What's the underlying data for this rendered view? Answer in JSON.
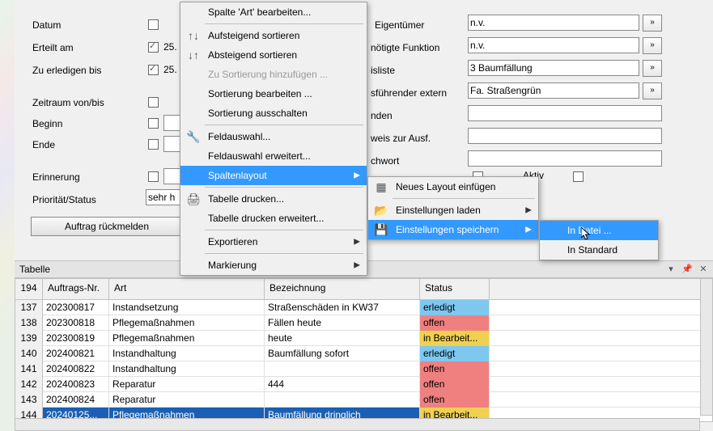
{
  "form": {
    "left": {
      "datum": "Datum",
      "erteilt_am": "Erteilt am",
      "erteilt_am_val": "25.",
      "zu_erledigen_bis": "Zu erledigen bis",
      "zu_erledigen_bis_val": "25.",
      "zeitraum": "Zeitraum von/bis",
      "beginn": "Beginn",
      "ende": "Ende",
      "erinnerung": "Erinnerung",
      "prioritaet": "Priorität/Status",
      "prioritaet_val": "sehr h"
    },
    "right": {
      "eigentuemer": "Eigentümer",
      "eigentuemer_val": "n.v.",
      "funktion": "nötigte Funktion",
      "funktion_val": "n.v.",
      "preisliste": "isliste",
      "preisliste_val": "3 Baumfällung",
      "extern": "sführender extern",
      "extern_val": "Fa. Straßengrün",
      "enden": "nden",
      "ausf": "weis zur Ausf.",
      "chwort": "chwort",
      "aktiv": "Aktiv"
    },
    "rueckmelden": "Auftrag rückmelden"
  },
  "menu": {
    "art_bearbeiten": "Spalte 'Art' bearbeiten...",
    "asc": "Aufsteigend sortieren",
    "desc": "Absteigend sortieren",
    "zu_sort": "Zu Sortierung hinzufügen ...",
    "sort_bearb": "Sortierung bearbeiten ...",
    "sort_aus": "Sortierung ausschalten",
    "feldaus": "Feldauswahl...",
    "feldaus_erw": "Feldauswahl erweitert...",
    "spaltenlayout": "Spaltenlayout",
    "drucken": "Tabelle drucken...",
    "drucken_erw": "Tabelle drucken erweitert...",
    "export": "Exportieren",
    "mark": "Markierung"
  },
  "submenu": {
    "neu": "Neues Layout einfügen",
    "laden": "Einstellungen laden",
    "speichern": "Einstellungen speichern"
  },
  "submenu2": {
    "in_datei": "In Datei ...",
    "in_standard": "In Standard"
  },
  "tabelle": {
    "title": "Tabelle",
    "cols": {
      "ix": "194",
      "auftrag": "Auftrags-Nr.",
      "art": "Art",
      "bez": "Bezeichnung",
      "status": "Status"
    },
    "rows": [
      {
        "ix": "137",
        "nr": "202300817",
        "art": "Instandsetzung",
        "bez": "Straßenschäden in KW37",
        "status": "erledigt",
        "sc": "erledigt"
      },
      {
        "ix": "138",
        "nr": "202300818",
        "art": "Pflegemaßnahmen",
        "bez": "Fällen heute",
        "status": "offen",
        "sc": "offen"
      },
      {
        "ix": "139",
        "nr": "202300819",
        "art": "Pflegemaßnahmen",
        "bez": "heute",
        "status": "in Bearbeit...",
        "sc": "bearb"
      },
      {
        "ix": "140",
        "nr": "202400821",
        "art": "Instandhaltung",
        "bez": "Baumfällung sofort",
        "status": "erledigt",
        "sc": "erledigt"
      },
      {
        "ix": "141",
        "nr": "202400822",
        "art": "Instandhaltung",
        "bez": "",
        "status": "offen",
        "sc": "offen"
      },
      {
        "ix": "142",
        "nr": "202400823",
        "art": "Reparatur",
        "bez": "444",
        "status": "offen",
        "sc": "offen"
      },
      {
        "ix": "143",
        "nr": "202400824",
        "art": "Reparatur",
        "bez": "",
        "status": "offen",
        "sc": "offen"
      },
      {
        "ix": "144",
        "nr": "20240125...",
        "art": "Pflegemaßnahmen",
        "bez": "Baumfällung dringlich",
        "status": "in Bearbeit...",
        "sc": "bearb",
        "sel": true
      }
    ]
  }
}
